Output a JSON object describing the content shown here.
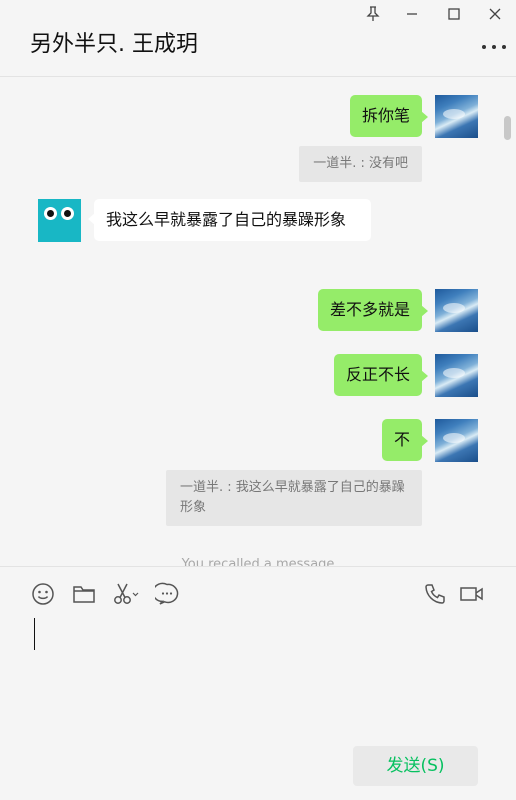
{
  "window": {
    "title": "另外半只. 王成玥",
    "controls": {
      "pin": "pin-icon",
      "minimize": "minimize-icon",
      "maximize": "maximize-icon",
      "close": "close-icon"
    }
  },
  "messages": {
    "m1": {
      "text": "拆你笔",
      "sender": "self"
    },
    "q1": {
      "text": "一道半. : 没有吧"
    },
    "m2": {
      "text": "我这么早就暴露了自己的暴躁形象",
      "sender": "contact"
    },
    "m3": {
      "text": "差不多就是",
      "sender": "self"
    },
    "m4": {
      "text": "反正不长",
      "sender": "self"
    },
    "m5": {
      "text": "不",
      "sender": "self"
    },
    "q2": {
      "text": "一道半. : 我这么早就暴露了自己的暴躁形象"
    },
    "system": {
      "text": "You recalled a message"
    }
  },
  "toolbar": {
    "icons": [
      "emoji-icon",
      "folder-icon",
      "scissors-icon",
      "chat-history-icon",
      "phone-icon",
      "video-call-icon"
    ]
  },
  "composer": {
    "input_value": "",
    "send_label": "发送(S)"
  },
  "colors": {
    "outgoing_bubble": "#95ec69",
    "incoming_bubble": "#ffffff",
    "background": "#f5f5f5",
    "send_text": "#07c160"
  }
}
